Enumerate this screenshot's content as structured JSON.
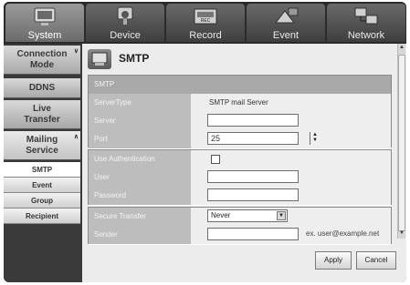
{
  "tabs": [
    {
      "label": "System",
      "icon": "monitor-icon",
      "active": true
    },
    {
      "label": "Device",
      "icon": "camera-icon",
      "active": false
    },
    {
      "label": "Record",
      "icon": "recorder-icon",
      "active": false
    },
    {
      "label": "Event",
      "icon": "event-icon",
      "active": false
    },
    {
      "label": "Network",
      "icon": "network-icon",
      "active": false
    }
  ],
  "sidebar": {
    "items": [
      {
        "label": "Connection Mode"
      },
      {
        "label": "DDNS"
      },
      {
        "label": "Live Transfer"
      },
      {
        "label": "Mailing Service"
      }
    ],
    "subitems": [
      {
        "label": "SMTP"
      },
      {
        "label": "Event"
      },
      {
        "label": "Group"
      },
      {
        "label": "Recipient"
      }
    ]
  },
  "page": {
    "title": "SMTP"
  },
  "smtp": {
    "section_label": "SMTP",
    "server_type_label": "ServerType",
    "server_type_value": "SMTP mail Server",
    "server_label": "Server",
    "server_value": "",
    "port_label": "Port",
    "port_value": "25"
  },
  "auth": {
    "use_auth_label": "Use Authentication",
    "use_auth_checked": false,
    "user_label": "User",
    "user_value": "",
    "password_label": "Password",
    "password_value": ""
  },
  "transfer": {
    "secure_label": "Secure Transfer",
    "secure_value": "Never",
    "sender_label": "Sender",
    "sender_value": "",
    "sender_hint": "ex. user@example.net"
  },
  "buttons": {
    "apply": "Apply",
    "cancel": "Cancel"
  }
}
